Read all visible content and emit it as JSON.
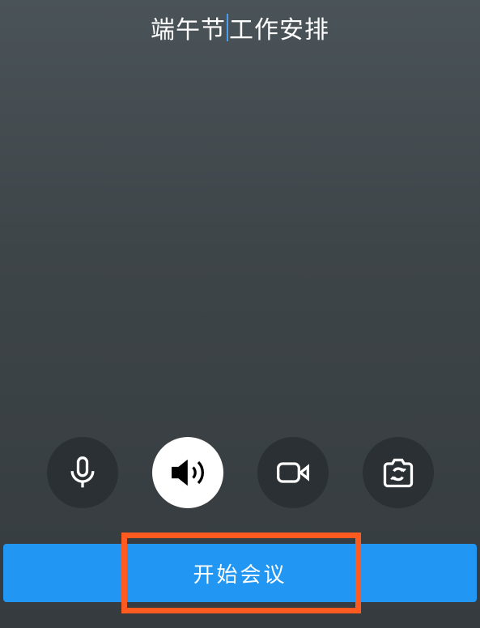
{
  "title": {
    "part1": "端午节",
    "part2": "工作安排"
  },
  "controls": {
    "mic": "microphone-icon",
    "speaker": "speaker-icon",
    "video": "video-icon",
    "camera_switch": "camera-switch-icon"
  },
  "startButton": {
    "label": "开始会议"
  }
}
